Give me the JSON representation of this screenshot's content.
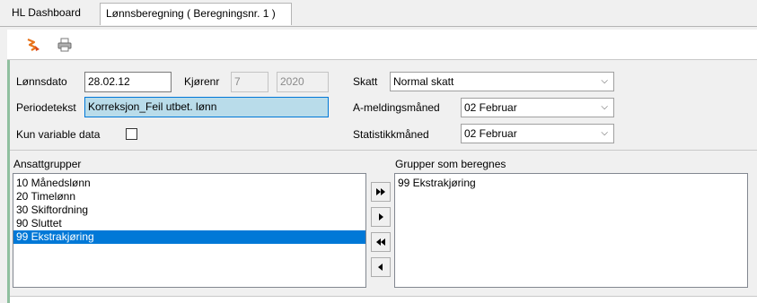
{
  "tabs": [
    {
      "label": "HL Dashboard"
    },
    {
      "label": "Lønnsberegning ( Beregningsnr. 1 )"
    }
  ],
  "toolbar": {
    "icons": [
      "calculate-icon",
      "printer-icon"
    ],
    "colors": {
      "calc": "#e8731a",
      "print": "#7a7a7a"
    }
  },
  "form": {
    "lonnsdato_label": "Lønnsdato",
    "lonnsdato_value": "28.02.12",
    "kjorenr_label": "Kjørenr",
    "kjorenr_value": "7",
    "year_value": "2020",
    "periodetekst_label": "Periodetekst",
    "periodetekst_value": "Korreksjon_Feil utbet. lønn",
    "kun_variable_label": "Kun variable data",
    "skatt_label": "Skatt",
    "skatt_value": "Normal skatt",
    "ameldingsmaned_label": "A-meldingsmåned",
    "ameldingsmaned_value": "02 Februar",
    "statistikkmaned_label": "Statistikkmåned",
    "statistikkmaned_value": "02 Februar"
  },
  "lists": {
    "left_title": "Ansattgrupper",
    "left_items": [
      "10  Månedslønn",
      "20  Timelønn",
      "30  Skiftordning",
      "90  Sluttet",
      "99  Ekstrakjøring"
    ],
    "left_selected_index": 4,
    "right_title": "Grupper som beregnes",
    "right_items": [
      "99  Ekstrakjøring"
    ]
  },
  "colors": {
    "selection": "#0078d7",
    "focus_field": "#b9dcea",
    "accent_bar": "#8fbf9f"
  }
}
